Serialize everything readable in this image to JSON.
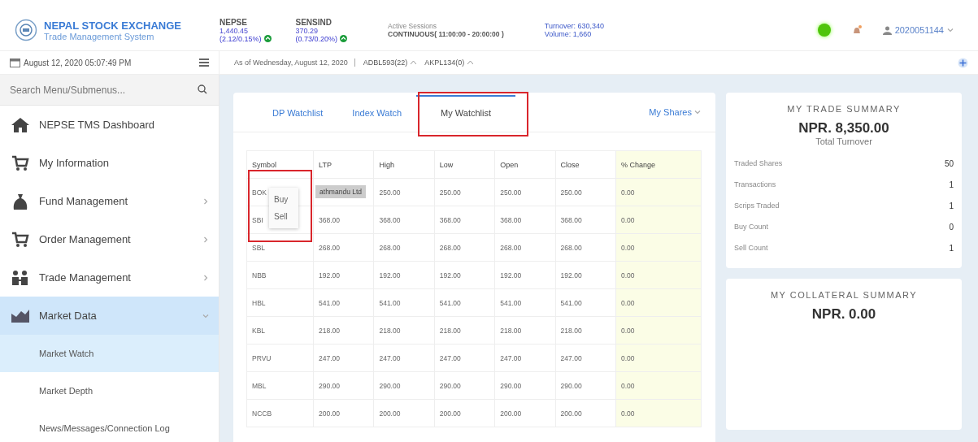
{
  "header": {
    "title": "NEPAL STOCK EXCHANGE",
    "subtitle": "Trade Management System",
    "indices": [
      {
        "name": "NEPSE",
        "value": "1,440.45",
        "change": "(2.12/0.15%)"
      },
      {
        "name": "SENSIND",
        "value": "370.29",
        "change": "(0.73/0.20%)"
      }
    ],
    "session_label": "Active Sessions",
    "session": "CONTINUOUS( 11:00:00 - 20:00:00 )",
    "turnover": "Turnover: 630,340",
    "volume": "Volume: 1,660",
    "user": "2020051144"
  },
  "datetime": "August 12, 2020 05:07:49 PM",
  "as_of": "As of Wednesday, August 12, 2020",
  "ticker": [
    {
      "text": "ADBL593(22)"
    },
    {
      "text": "AKPL134(0)"
    }
  ],
  "sidebar": {
    "search_placeholder": "Search Menu/Submenus...",
    "items": [
      {
        "label": "NEPSE TMS Dashboard",
        "kind": "link",
        "selected": false
      },
      {
        "label": "My Information",
        "kind": "link",
        "selected": false
      },
      {
        "label": "Fund Management",
        "kind": "group",
        "selected": false,
        "expanded": false
      },
      {
        "label": "Order Management",
        "kind": "group",
        "selected": false,
        "expanded": false
      },
      {
        "label": "Trade Management",
        "kind": "group",
        "selected": false,
        "expanded": false
      },
      {
        "label": "Market Data",
        "kind": "group",
        "selected": true,
        "expanded": true,
        "children": [
          {
            "label": "Market Watch",
            "selected": true
          },
          {
            "label": "Market Depth",
            "selected": false
          },
          {
            "label": "News/Messages/Connection Log",
            "selected": false
          }
        ]
      }
    ]
  },
  "tabs": [
    {
      "label": "DP Watchlist",
      "selected": false
    },
    {
      "label": "Index Watch",
      "selected": false
    },
    {
      "label": "My Watchlist",
      "selected": true
    }
  ],
  "my_shares": "My Shares",
  "table": {
    "columns": [
      "Symbol",
      "LTP",
      "High",
      "Low",
      "Open",
      "Close",
      "% Change"
    ],
    "rows": [
      [
        "BOK",
        "",
        "250.00",
        "250.00",
        "250.00",
        "250.00",
        "0.00"
      ],
      [
        "SBI",
        "368.00",
        "368.00",
        "368.00",
        "368.00",
        "368.00",
        "0.00"
      ],
      [
        "SBL",
        "268.00",
        "268.00",
        "268.00",
        "268.00",
        "268.00",
        "0.00"
      ],
      [
        "NBB",
        "192.00",
        "192.00",
        "192.00",
        "192.00",
        "192.00",
        "0.00"
      ],
      [
        "HBL",
        "541.00",
        "541.00",
        "541.00",
        "541.00",
        "541.00",
        "0.00"
      ],
      [
        "KBL",
        "218.00",
        "218.00",
        "218.00",
        "218.00",
        "218.00",
        "0.00"
      ],
      [
        "PRVU",
        "247.00",
        "247.00",
        "247.00",
        "247.00",
        "247.00",
        "0.00"
      ],
      [
        "MBL",
        "290.00",
        "290.00",
        "290.00",
        "290.00",
        "290.00",
        "0.00"
      ],
      [
        "NCCB",
        "200.00",
        "200.00",
        "200.00",
        "200.00",
        "200.00",
        "0.00"
      ]
    ]
  },
  "tooltip": "athmandu Ltd",
  "context_menu": [
    "Buy",
    "Sell"
  ],
  "trade_summary": {
    "title": "MY TRADE SUMMARY",
    "amount": "NPR. 8,350.00",
    "caption": "Total Turnover",
    "rows": [
      {
        "label": "Traded Shares",
        "value": "50"
      },
      {
        "label": "Transactions",
        "value": "1"
      },
      {
        "label": "Scrips Traded",
        "value": "1"
      },
      {
        "label": "Buy Count",
        "value": "0"
      },
      {
        "label": "Sell Count",
        "value": "1"
      }
    ]
  },
  "collateral_summary": {
    "title": "MY COLLATERAL SUMMARY",
    "amount": "NPR. 0.00"
  }
}
